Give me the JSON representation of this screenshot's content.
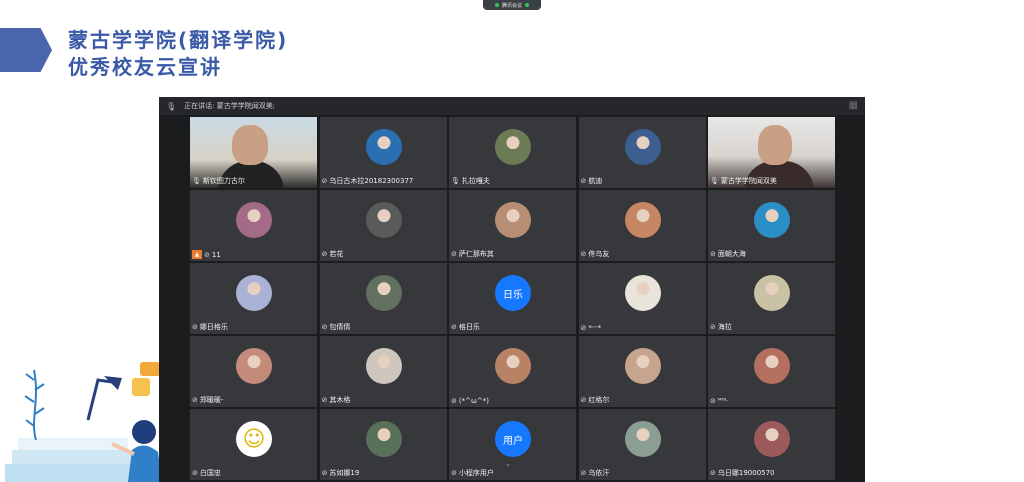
{
  "slide": {
    "title_line1": "蒙古学学院(翻译学院)",
    "title_line2": "优秀校友云宣讲"
  },
  "meeting_bar": {
    "label": "腾讯会议",
    "status_color": "#34c759"
  },
  "window": {
    "speaking_label": "正在讲话: 蒙古学学院闻双美;",
    "mic_icon": "mic-icon",
    "view_icon": "gallery-view-icon"
  },
  "participants": [
    {
      "name": "斯钦图力古尔",
      "avatar": "video"
    },
    {
      "name": "乌日古木拉20182300377",
      "avatar": "photo",
      "color": "#2b6fb3"
    },
    {
      "name": "扎拉嘎夫",
      "avatar": "photo",
      "color": "#6b7b55"
    },
    {
      "name": "航迪",
      "avatar": "photo",
      "color": "#3d5f8f"
    },
    {
      "name": "蒙古学学院闻双美",
      "avatar": "video"
    },
    {
      "name": "11",
      "avatar": "photo",
      "color": "#a46b88",
      "host": true
    },
    {
      "name": "若花",
      "avatar": "photo",
      "color": "#5b5b5b"
    },
    {
      "name": "萨仁那布其",
      "avatar": "photo",
      "color": "#b78e74"
    },
    {
      "name": "佟乌友",
      "avatar": "photo",
      "color": "#c48663"
    },
    {
      "name": "面朝大海",
      "avatar": "photo",
      "color": "#2a8fc6"
    },
    {
      "name": "娜日格乐",
      "avatar": "photo",
      "color": "#aab3d6"
    },
    {
      "name": "包倩倩",
      "avatar": "photo",
      "color": "#627060"
    },
    {
      "name": "格日乐",
      "avatar": "letter",
      "letter": "日乐"
    },
    {
      "name": "*ᵕᵕ*",
      "avatar": "photo",
      "color": "#e9e4da"
    },
    {
      "name": "海拉",
      "avatar": "photo",
      "color": "#c9c2a4"
    },
    {
      "name": "郑暖暖-",
      "avatar": "photo",
      "color": "#c48b7a"
    },
    {
      "name": "其木格",
      "avatar": "photo",
      "color": "#cfc7bd"
    },
    {
      "name": "(*^ω^*)",
      "avatar": "photo",
      "color": "#b88364"
    },
    {
      "name": "红格尔",
      "avatar": "photo",
      "color": "#c7a48d"
    },
    {
      "name": "ᴹᴼᴸ",
      "avatar": "photo",
      "color": "#b46f5f"
    },
    {
      "name": "白国忠",
      "avatar": "emoji",
      "emoji": "☺"
    },
    {
      "name": "苏如娜19",
      "avatar": "photo",
      "color": "#59705a"
    },
    {
      "name": "小程序用户",
      "avatar": "letter",
      "letter": "用户"
    },
    {
      "name": "乌依汗",
      "avatar": "photo",
      "color": "#8b9e93"
    },
    {
      "name": "乌日娜19000570",
      "avatar": "photo",
      "color": "#9c5b5a"
    }
  ],
  "more_chevron": "⌄"
}
